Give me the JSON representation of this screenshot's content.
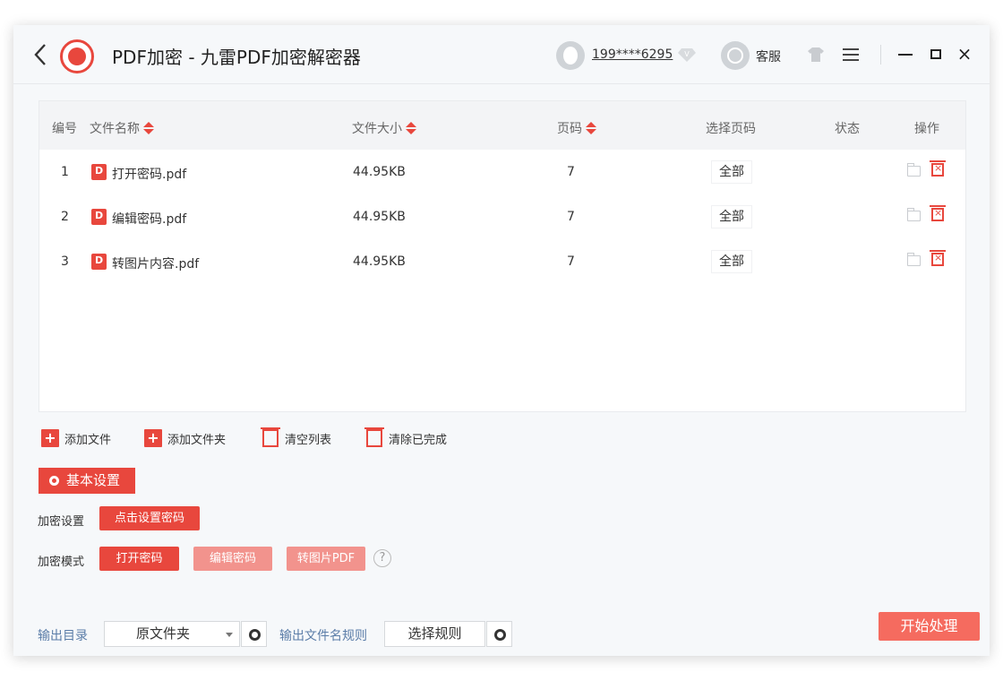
{
  "header": {
    "title": "PDF加密 - 九雷PDF加密解密器",
    "user_phone": "199****6295",
    "service_label": "客服"
  },
  "table": {
    "columns": {
      "index": "编号",
      "name": "文件名称",
      "size": "文件大小",
      "pages": "页码",
      "select_pages": "选择页码",
      "status": "状态",
      "actions": "操作"
    },
    "rows": [
      {
        "index": "1",
        "name": "打开密码.pdf",
        "size": "44.95KB",
        "pages": "7",
        "select_pages": "全部",
        "status": ""
      },
      {
        "index": "2",
        "name": "编辑密码.pdf",
        "size": "44.95KB",
        "pages": "7",
        "select_pages": "全部",
        "status": ""
      },
      {
        "index": "3",
        "name": "转图片内容.pdf",
        "size": "44.95KB",
        "pages": "7",
        "select_pages": "全部",
        "status": ""
      }
    ]
  },
  "toolbar": {
    "add_file": "添加文件",
    "add_folder": "添加文件夹",
    "clear_list": "清空列表",
    "clear_done": "清除已完成"
  },
  "settings": {
    "header": "基本设置",
    "encrypt_label": "加密设置",
    "set_password_button": "点击设置密码",
    "mode_label": "加密模式",
    "modes": [
      "打开密码",
      "编辑密码",
      "转图片PDF"
    ],
    "selected_mode": "打开密码",
    "help": "?"
  },
  "footer": {
    "output_dir_label": "输出目录",
    "output_dir_value": "原文件夹",
    "filename_rule_label": "输出文件名规则",
    "filename_rule_value": "选择规则",
    "start_button": "开始处理"
  },
  "colors": {
    "accent": "#e8473d",
    "accent_light": "#f2938d",
    "link": "#5b7da8"
  }
}
